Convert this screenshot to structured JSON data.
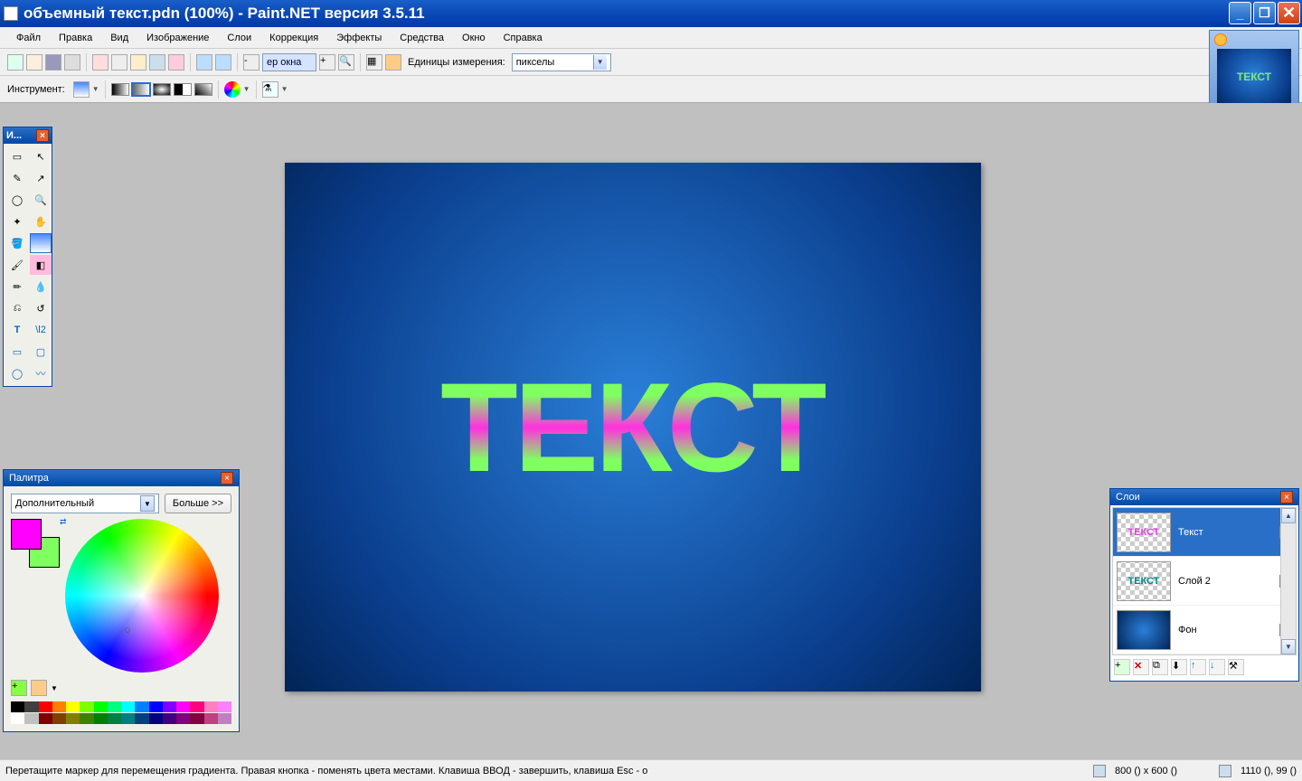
{
  "titlebar": {
    "text": "объемный текст.pdn (100%) - Paint.NET версия 3.5.11"
  },
  "menu": {
    "file": "Файл",
    "edit": "Правка",
    "view": "Вид",
    "image": "Изображение",
    "layers": "Слои",
    "correction": "Коррекция",
    "effects": "Эффекты",
    "tools": "Средства",
    "window": "Окно",
    "help": "Справка"
  },
  "toolbar": {
    "zoom_value": "ер окна",
    "units_label": "Единицы измерения:",
    "units_value": "пикселы",
    "instrument_label": "Инструмент:"
  },
  "thumbnail_text": "ТЕКСТ",
  "canvas_text": "ТЕКСТ",
  "tools_window": {
    "title": "И..."
  },
  "palette": {
    "title": "Палитра",
    "mode": "Дополнительный",
    "more": "Больше >>"
  },
  "layers": {
    "title": "Слои",
    "items": [
      {
        "name": "Текст",
        "checked": true
      },
      {
        "name": "Слой 2",
        "checked": false
      },
      {
        "name": "Фон",
        "checked": true
      }
    ]
  },
  "status": {
    "hint": "Перетащите маркер для перемещения градиента. Правая кнопка - поменять цвета местами. Клавиша ВВОД - завершить, клавиша Esc - о",
    "size": "800 () x 600 ()",
    "pos": "1110 (), 99 ()"
  },
  "palette_colors_row1": [
    "#000000",
    "#404040",
    "#ff0000",
    "#ff8000",
    "#ffff00",
    "#80ff00",
    "#00ff00",
    "#00ff80",
    "#00ffff",
    "#0080ff",
    "#0000ff",
    "#8000ff",
    "#ff00ff",
    "#ff0080",
    "#ff80c0",
    "#ff80ff"
  ],
  "palette_colors_row2": [
    "#ffffff",
    "#c0c0c0",
    "#800000",
    "#804000",
    "#808000",
    "#408000",
    "#008000",
    "#008040",
    "#008080",
    "#004080",
    "#000080",
    "#400080",
    "#800080",
    "#800040",
    "#c04080",
    "#c080c0"
  ]
}
